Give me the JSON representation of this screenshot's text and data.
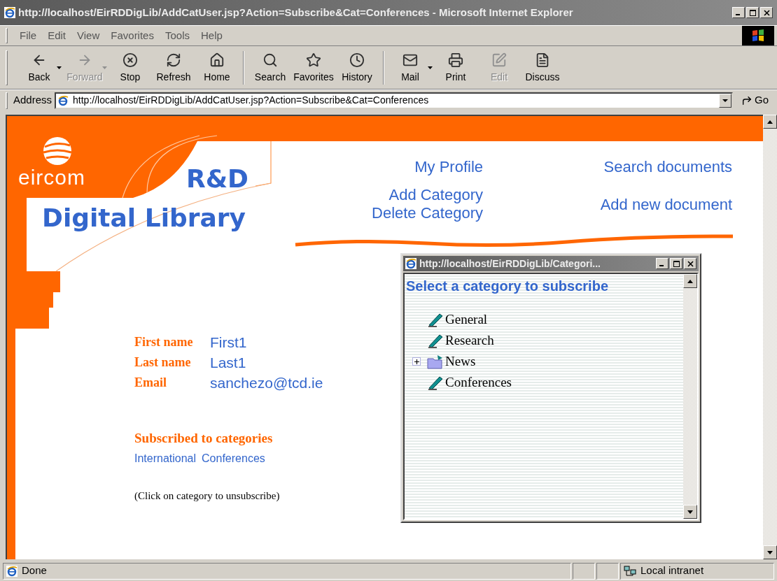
{
  "window": {
    "title": "http://localhost/EirRDDigLib/AddCatUser.jsp?Action=Subscribe&Cat=Conferences - Microsoft Internet Explorer",
    "active": false
  },
  "menu": [
    "File",
    "Edit",
    "View",
    "Favorites",
    "Tools",
    "Help"
  ],
  "toolbar": [
    [
      {
        "label": "Back",
        "disabled": false,
        "dropdown": true
      },
      {
        "label": "Forward",
        "disabled": true,
        "dropdown": true
      },
      {
        "label": "Stop",
        "disabled": false,
        "dropdown": false
      },
      {
        "label": "Refresh",
        "disabled": false,
        "dropdown": false
      },
      {
        "label": "Home",
        "disabled": false,
        "dropdown": false
      }
    ],
    [
      {
        "label": "Search",
        "disabled": false,
        "dropdown": false
      },
      {
        "label": "Favorites",
        "disabled": false,
        "dropdown": false
      },
      {
        "label": "History",
        "disabled": false,
        "dropdown": false
      }
    ],
    [
      {
        "label": "Mail",
        "disabled": false,
        "dropdown": true
      },
      {
        "label": "Print",
        "disabled": false,
        "dropdown": false
      },
      {
        "label": "Edit",
        "disabled": true,
        "dropdown": false
      },
      {
        "label": "Discuss",
        "disabled": false,
        "dropdown": false
      }
    ]
  ],
  "address": {
    "label": "Address",
    "value": "http://localhost/EirRDDigLib/AddCatUser.jsp?Action=Subscribe&Cat=Conferences",
    "go": "Go"
  },
  "page": {
    "logo": "eircom",
    "brand_top": "R&D",
    "brand_bottom": "Digital Library",
    "nav_left": [
      "My Profile",
      "Add Category",
      "Delete Category"
    ],
    "nav_right": [
      "Search documents",
      "Add new document"
    ],
    "profile": [
      {
        "label": "First name",
        "value": "First1"
      },
      {
        "label": "Last name",
        "value": "Last1"
      },
      {
        "label": "Email",
        "value": "sanchezo@tcd.ie"
      }
    ],
    "subscribed_heading": "Subscribed to categories",
    "subscribed": [
      "International",
      "Conferences"
    ],
    "hint": "(Click on category to unsubscribe)"
  },
  "popup": {
    "title": "http://localhost/EirRDDigLib/Categori...",
    "active": false,
    "heading": "Select a category to subscribe",
    "tree": [
      {
        "label": "General",
        "kind": "leaf"
      },
      {
        "label": "Research",
        "kind": "leaf"
      },
      {
        "label": "News",
        "kind": "folder",
        "expanded": false
      },
      {
        "label": "Conferences",
        "kind": "leaf"
      }
    ]
  },
  "status_bar": {
    "text": "Done",
    "zone": "Local intranet"
  }
}
